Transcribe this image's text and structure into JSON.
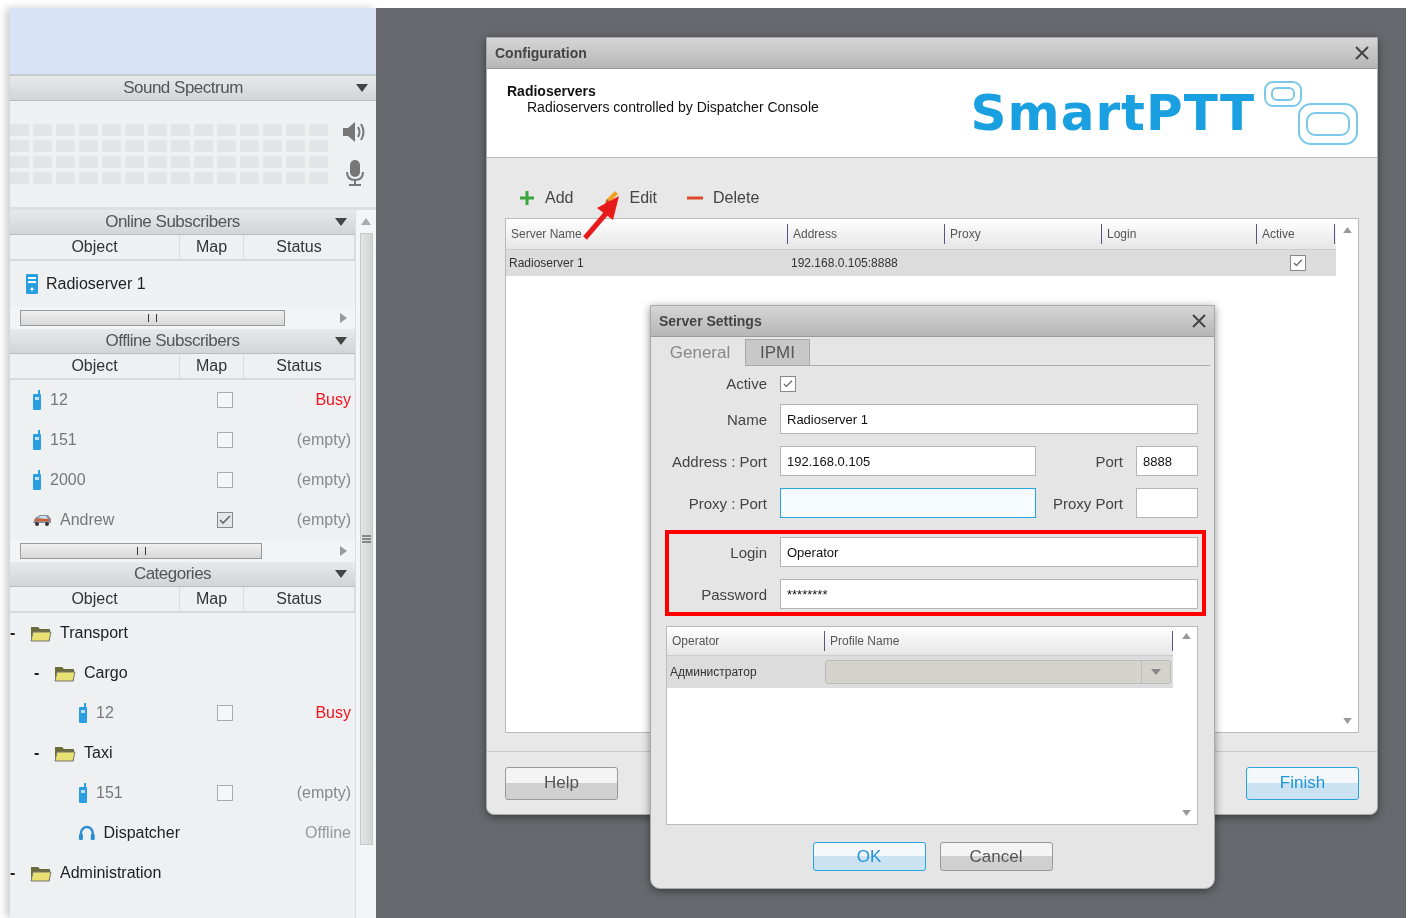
{
  "left_panel": {
    "sound_spectrum": {
      "title": "Sound Spectrum"
    },
    "online_subscribers": {
      "title": "Online Subscribers",
      "columns": [
        "Object",
        "Map",
        "Status"
      ],
      "rows": [
        {
          "kind": "server",
          "name": "Radioserver 1"
        }
      ]
    },
    "offline_subscribers": {
      "title": "Offline Subscribers",
      "columns": [
        "Object",
        "Map",
        "Status"
      ],
      "rows": [
        {
          "kind": "radio",
          "name": "12",
          "on_map": false,
          "status": "Busy",
          "color": "#f0141e"
        },
        {
          "kind": "radio",
          "name": "151",
          "on_map": false,
          "status": "(empty)",
          "color": "#888888"
        },
        {
          "kind": "radio",
          "name": "2000",
          "on_map": false,
          "status": "(empty)",
          "color": "#888888"
        },
        {
          "kind": "car",
          "name": "Andrew",
          "on_map": true,
          "status": "(empty)",
          "color": "#888888"
        }
      ]
    },
    "categories": {
      "title": "Categories",
      "columns": [
        "Object",
        "Map",
        "Status"
      ],
      "tree": [
        {
          "kind": "folder",
          "toggle": "-",
          "name": "Transport",
          "children": [
            {
              "kind": "folder",
              "toggle": "-",
              "name": "Cargo",
              "children": [
                {
                  "kind": "radio",
                  "name": "12",
                  "on_map": false,
                  "status": "Busy",
                  "color": "#f0141e"
                }
              ]
            },
            {
              "kind": "folder",
              "toggle": "-",
              "name": "Taxi",
              "children": [
                {
                  "kind": "radio",
                  "name": "151",
                  "on_map": false,
                  "status": "(empty)",
                  "color": "#888888"
                },
                {
                  "kind": "dispatcher",
                  "name": "Dispatcher",
                  "status": "Offline",
                  "color": "#999999"
                }
              ]
            }
          ]
        },
        {
          "kind": "folder",
          "toggle": "-",
          "name": "Administration"
        }
      ]
    }
  },
  "configuration": {
    "title": "Configuration",
    "header": {
      "title": "Radioservers",
      "subtitle": "Radioservers controlled by Dispatcher Console"
    },
    "logo": "SmartPTT",
    "toolbar": [
      {
        "kind": "add",
        "label": "Add"
      },
      {
        "kind": "edit",
        "label": "Edit"
      },
      {
        "kind": "delete",
        "label": "Delete"
      }
    ],
    "table": {
      "columns": [
        "Server Name",
        "Address",
        "Proxy",
        "Login",
        "Active"
      ],
      "rows": [
        {
          "server_name": "Radioserver 1",
          "address": "192.168.0.105:8888",
          "active": true,
          "selected": true
        }
      ]
    },
    "buttons": [
      {
        "label": "Help",
        "default": false
      },
      {
        "label": "Finish",
        "default": true
      }
    ]
  },
  "server_settings": {
    "title": "Server Settings",
    "tabs": [
      {
        "label": "General",
        "selected": true
      },
      {
        "label": "IPMI",
        "selected": false
      }
    ],
    "active": {
      "label": "Active",
      "checked": true
    },
    "name": {
      "label": "Name",
      "value": "Radioserver 1"
    },
    "address": {
      "label": "Address : Port",
      "value": "192.168.0.105"
    },
    "port": {
      "label": "Port",
      "value": "8888"
    },
    "proxy": {
      "label": "Proxy : Port",
      "focused": true
    },
    "proxy_port": {
      "label": "Proxy Port"
    },
    "login": {
      "label": "Login",
      "value": "Operator"
    },
    "password": {
      "label": "Password",
      "value": "********"
    },
    "operators": {
      "columns": [
        "Operator",
        "Profile Name"
      ],
      "rows": [
        {
          "operator": "Администратор",
          "selected": true
        }
      ]
    },
    "buttons": [
      {
        "label": "OK",
        "default": true
      },
      {
        "label": "Cancel",
        "default": false
      }
    ]
  }
}
